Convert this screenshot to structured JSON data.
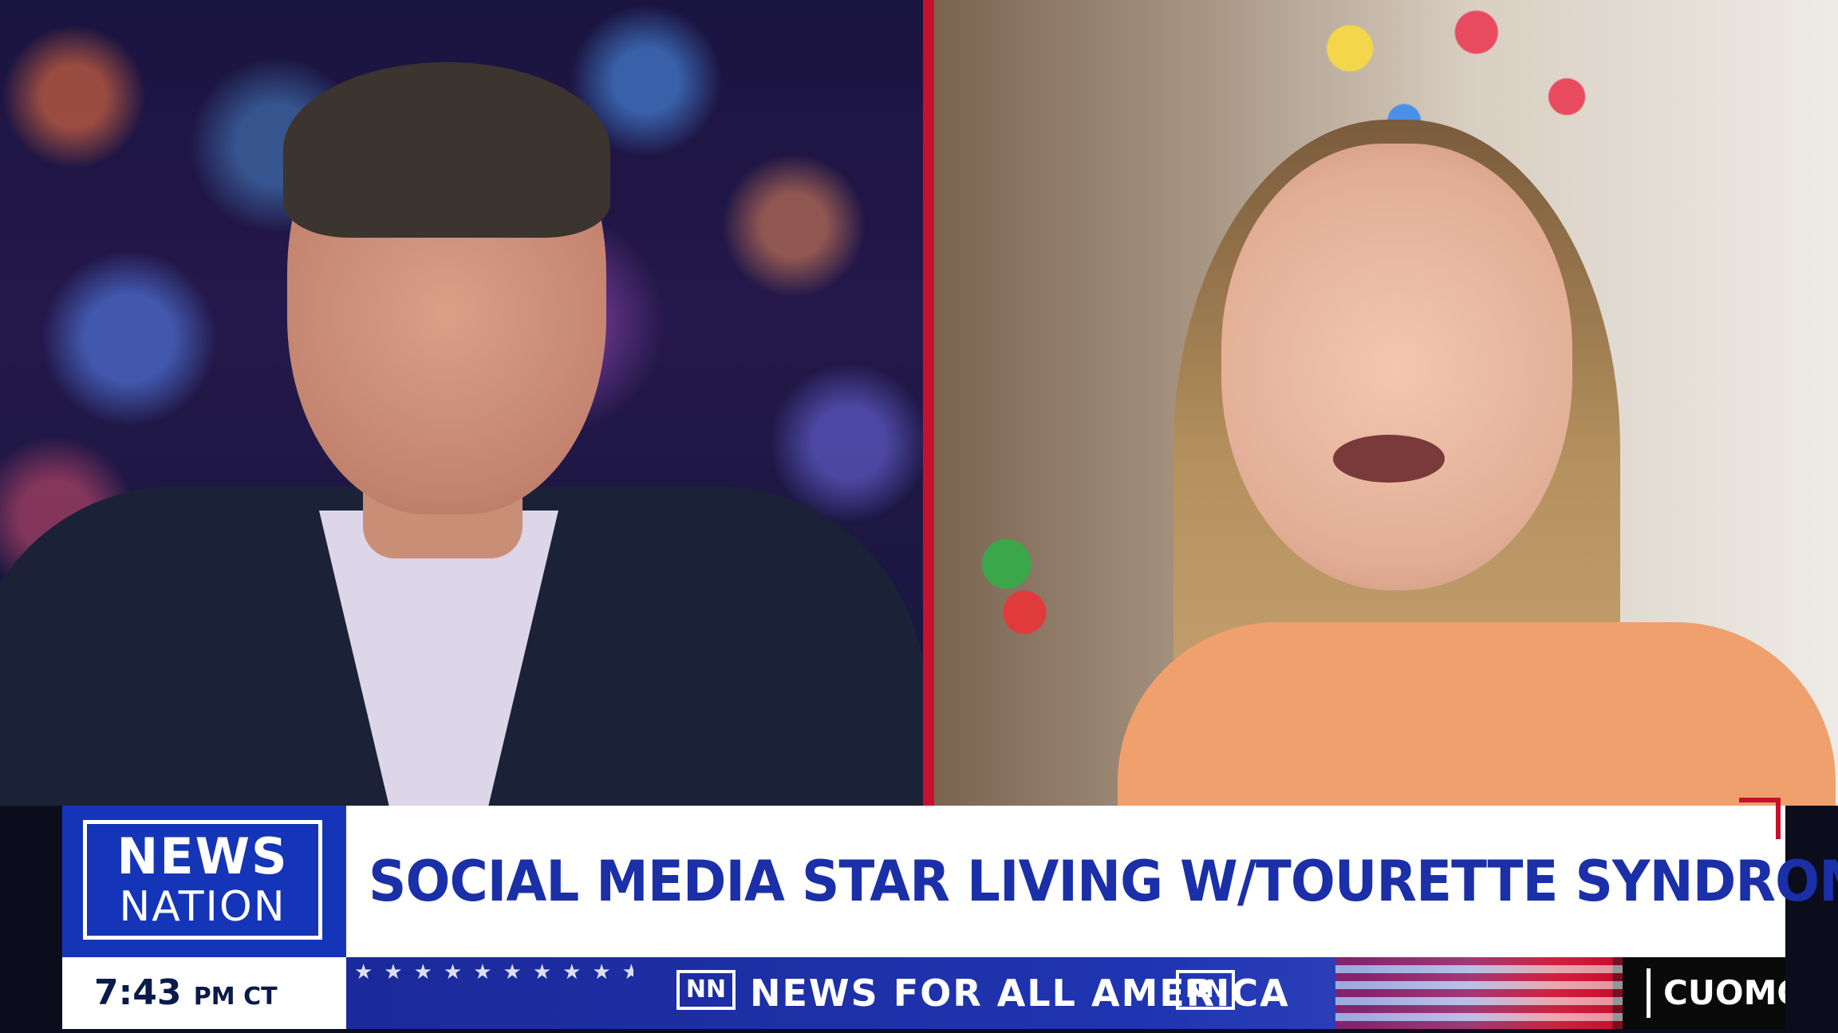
{
  "network": {
    "logo_line1": "NEWS",
    "logo_line2": "NATION",
    "brand_color": "#1535b8",
    "accent_color": "#c8102e"
  },
  "headline": {
    "text": "SOCIAL MEDIA STAR LIVING W/TOURETTE SYNDROME",
    "text_color": "#1a2fa8"
  },
  "clock": {
    "time": "7:43",
    "suffix": "PM CT"
  },
  "ticker": {
    "icon_left": "NN",
    "tagline": "NEWS FOR ALL AMERICA",
    "icon_right": "NN"
  },
  "show": {
    "name": "CUOMO"
  },
  "panels": {
    "left": "anchor-video-feed",
    "right": "guest-video-feed"
  }
}
